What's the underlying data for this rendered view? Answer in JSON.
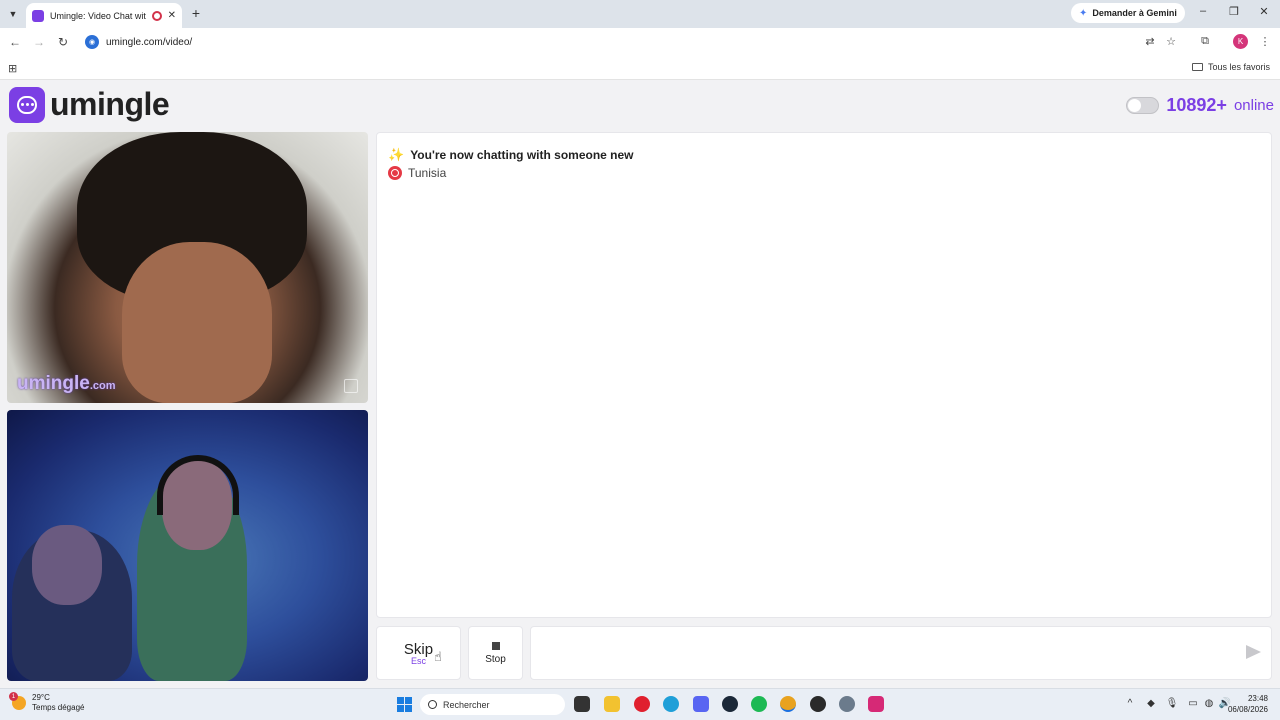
{
  "browser": {
    "tab_title": "Umingle: Video Chat with S",
    "gemini_label": "Demander à Gemini",
    "url": "umingle.com/video/",
    "bookmarks_label": "Tous les favoris",
    "profile_initial": "K"
  },
  "header": {
    "logo_text": "umingle",
    "online_count": "10892+",
    "online_label": "online"
  },
  "video": {
    "watermark": "umingle",
    "watermark_domain": ".com"
  },
  "chat": {
    "messages": [
      "You're now chatting with someone new",
      "Tunisia"
    ]
  },
  "controls": {
    "skip_label": "Skip",
    "skip_key": "Esc",
    "stop_label": "Stop",
    "message_placeholder": ""
  },
  "taskbar": {
    "temperature": "29°C",
    "weather": "Temps dégagé",
    "weather_alert_count": "1",
    "search_label": "Rechercher",
    "time": "23:48",
    "date": "06/08/2026"
  },
  "colors": {
    "accent": "#7b3fe4",
    "flag_red": "#e53945"
  }
}
